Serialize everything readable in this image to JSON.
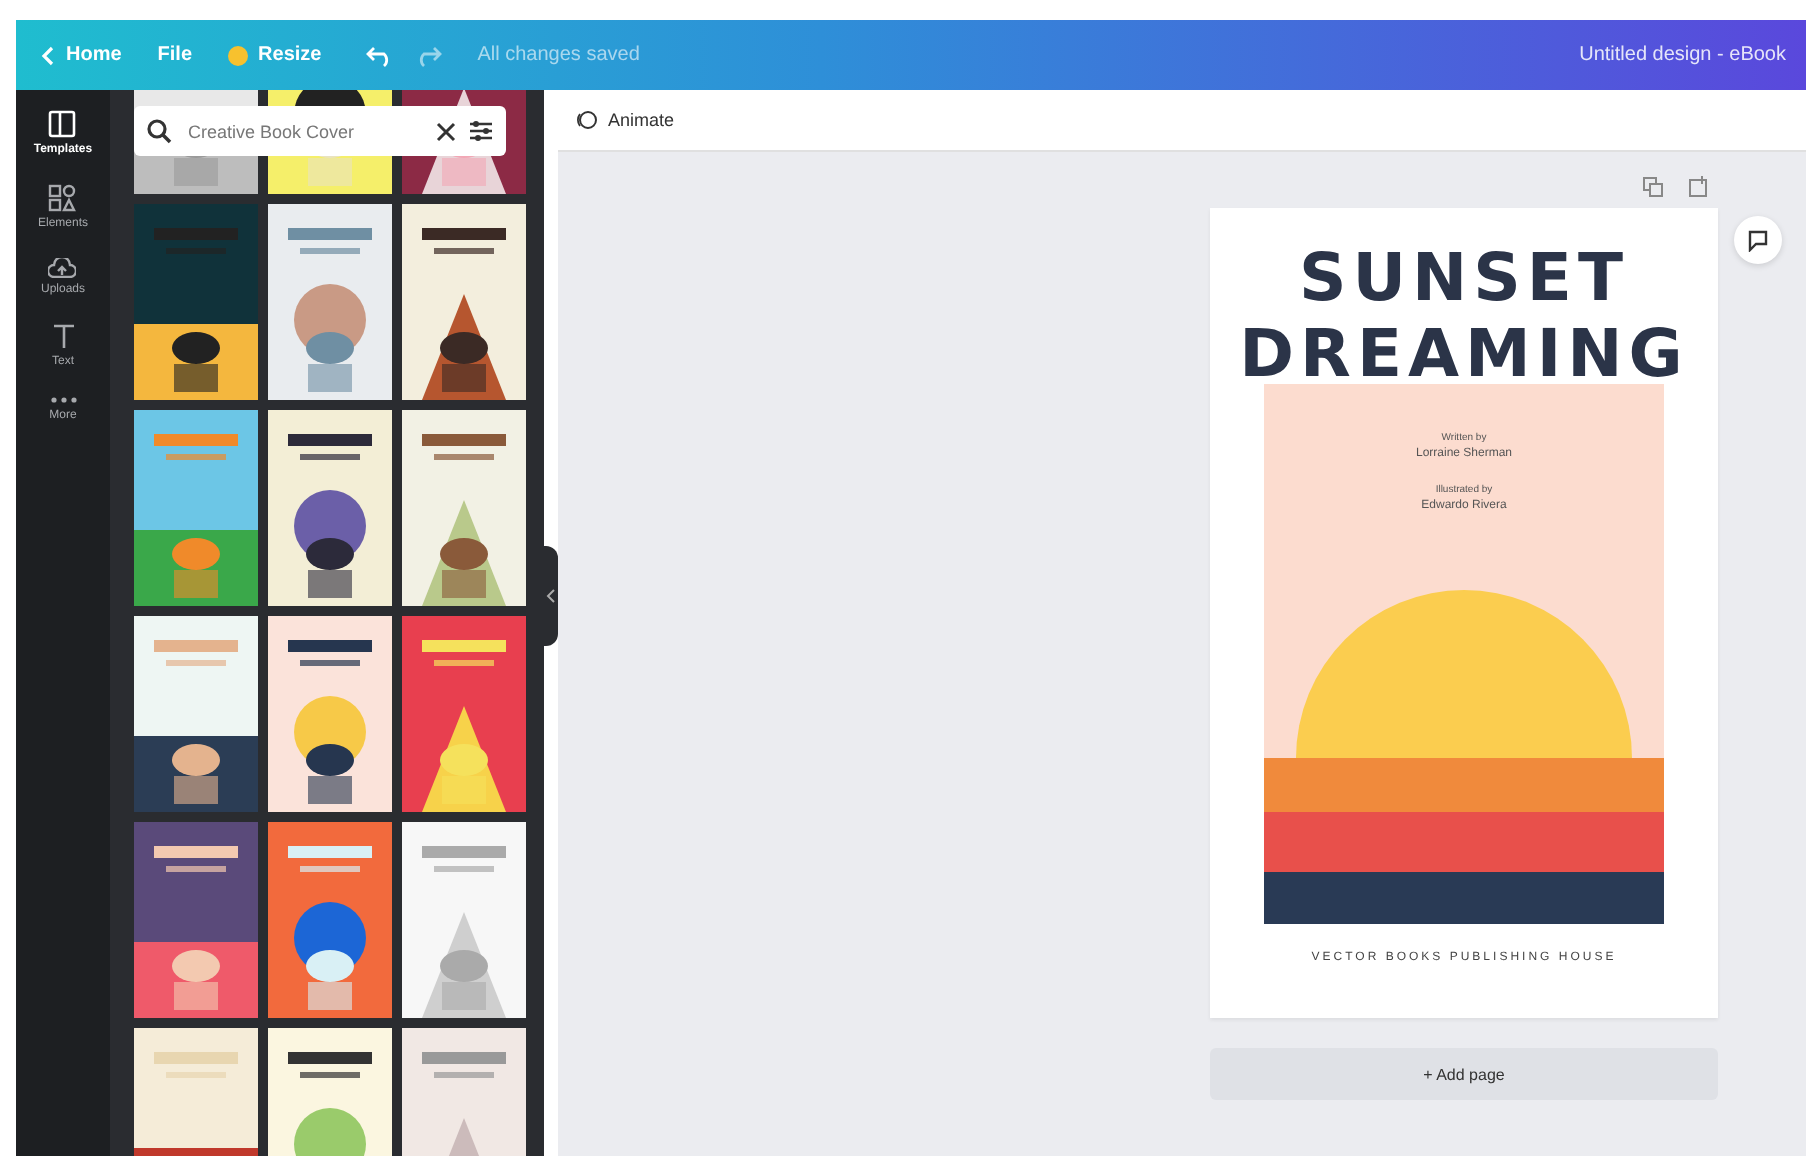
{
  "topbar": {
    "back": "Home",
    "menu": [
      "File",
      "Resize"
    ],
    "status": "All changes saved",
    "title": "Untitled design - eBook"
  },
  "sidebar": {
    "items": [
      {
        "label": "Templates",
        "kind": "templates",
        "selected": true
      },
      {
        "label": "Elements",
        "kind": "elements",
        "selected": false
      },
      {
        "label": "Uploads",
        "kind": "uploads",
        "selected": false
      },
      {
        "label": "Text",
        "kind": "text",
        "selected": false
      },
      {
        "label": "More",
        "kind": "more",
        "selected": false
      }
    ]
  },
  "search": {
    "value": "Creative Book Cover"
  },
  "toolbar": {
    "animate": "Animate"
  },
  "page": {
    "title": [
      "SUNSET",
      "DREAMING"
    ],
    "credits": [
      "Written by",
      "Lorraine Sherman",
      "Illustrated by",
      "Edwardo Rivera"
    ],
    "publisher": "VECTOR BOOKS PUBLISHING HOUSE"
  },
  "add_page": "+ Add page"
}
